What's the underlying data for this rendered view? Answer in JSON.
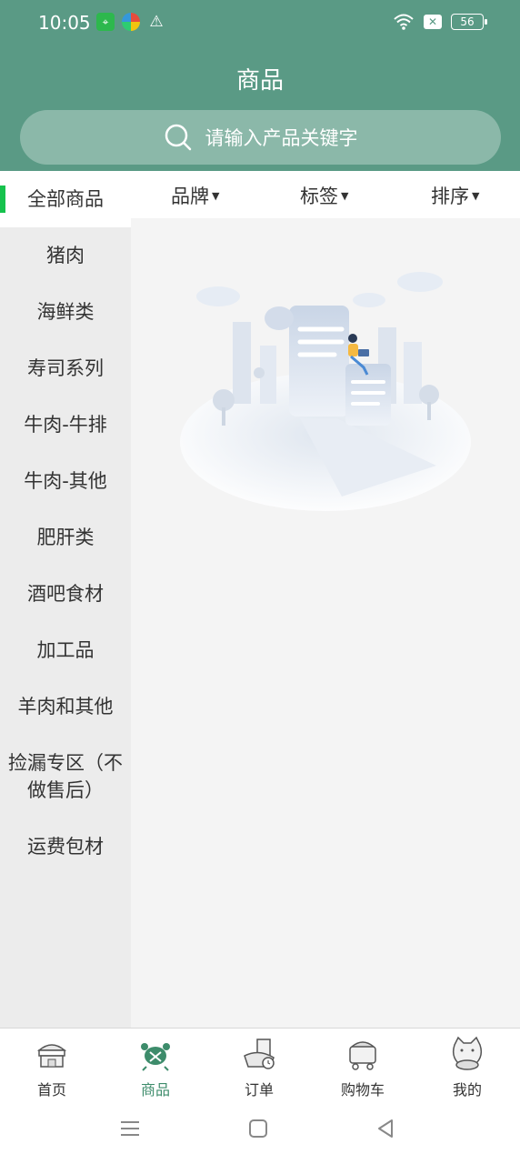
{
  "status_bar": {
    "time": "10:05",
    "battery": "56"
  },
  "header": {
    "title": "商品"
  },
  "search": {
    "placeholder": "请输入产品关键字"
  },
  "sidebar": {
    "items": [
      {
        "label": "全部商品"
      },
      {
        "label": "猪肉"
      },
      {
        "label": "海鲜类"
      },
      {
        "label": "寿司系列"
      },
      {
        "label": "牛肉-牛排"
      },
      {
        "label": "牛肉-其他"
      },
      {
        "label": "肥肝类"
      },
      {
        "label": "酒吧食材"
      },
      {
        "label": "加工品"
      },
      {
        "label": "羊肉和其他"
      },
      {
        "label": "捡漏专区（不做售后）"
      },
      {
        "label": "运费包材"
      }
    ]
  },
  "filters": [
    {
      "label": "品牌"
    },
    {
      "label": "标签"
    },
    {
      "label": "排序"
    }
  ],
  "tabbar": {
    "tabs": [
      {
        "label": "首页",
        "icon": "shop-icon"
      },
      {
        "label": "商品",
        "icon": "crab-icon"
      },
      {
        "label": "订单",
        "icon": "order-icon"
      },
      {
        "label": "购物车",
        "icon": "cart-icon"
      },
      {
        "label": "我的",
        "icon": "cat-icon"
      }
    ]
  },
  "colors": {
    "header": "#5a9a85",
    "accent": "#16c24d",
    "tab_active": "#3d8c6b"
  }
}
